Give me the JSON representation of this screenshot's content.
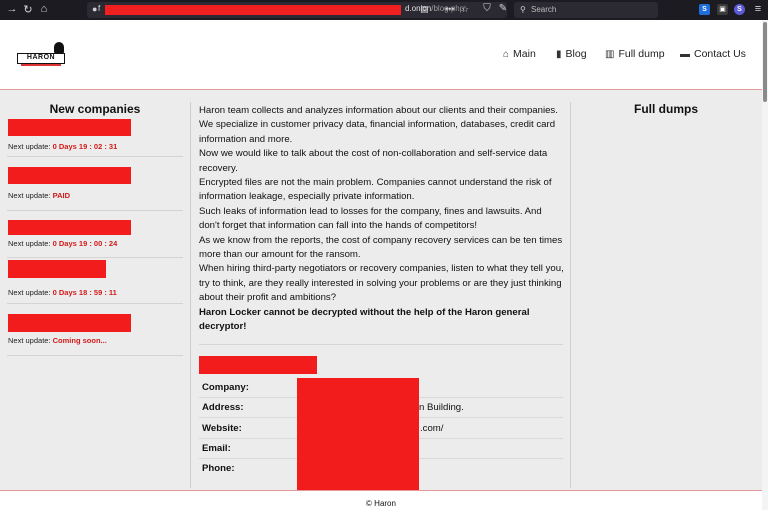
{
  "browser": {
    "url_visible_start": "f",
    "url_host_end": "d.onion",
    "url_path": "/blog.php",
    "search_placeholder": "Search"
  },
  "header": {
    "logo_text": "HARON",
    "nav": [
      {
        "label": "Main",
        "icon": "home-icon"
      },
      {
        "label": "Blog",
        "icon": "file-icon"
      },
      {
        "label": "Full dump",
        "icon": "book-icon"
      },
      {
        "label": "Contact Us",
        "icon": "chat-icon"
      }
    ]
  },
  "left": {
    "title": "New companies",
    "next_label": "Next update:",
    "companies": [
      {
        "status": "0 Days 19 : 02 : 31"
      },
      {
        "status": "PAID"
      },
      {
        "status": "0 Days 19 : 00 : 24"
      },
      {
        "status": "0 Days 18 : 59 : 11"
      },
      {
        "status": "Coming soon..."
      }
    ]
  },
  "main": {
    "paragraphs": [
      "Haron team collects and analyzes information about our clients and their companies. We specialize in customer privacy data, financial information, databases, credit card information and more.",
      "Now we would like to talk about the cost of non-collaboration and self-service data recovery.",
      "Encrypted files are not the main problem. Companies cannot understand the risk of information leakage, especially private information.",
      "Such leaks of information lead to losses for the company, fines and lawsuits. And don't forget that information can fall into the hands of competitors!",
      "As we know from the reports, the cost of company recovery services can be ten times more than our amount for the ransom.",
      "When hiring third-party negotiators or recovery companies, listen to what they tell you, try to think, are they really interested in solving your problems or are they just thinking about their profit and ambitions?"
    ],
    "bold_paragraph": "Haron Locker cannot be decrypted without the help of the Haron general decryptor!",
    "details": [
      {
        "label": "Company:",
        "value": ""
      },
      {
        "label": "Address:",
        "value": "n Building."
      },
      {
        "label": "Website:",
        "value": ".com/"
      },
      {
        "label": "Email:",
        "value": ""
      },
      {
        "label": "Phone:",
        "value": ""
      }
    ]
  },
  "right": {
    "title": "Full dumps"
  },
  "footer": {
    "text": "© Haron"
  },
  "colors": {
    "accent_red": "#d21a1a",
    "redaction": "#f21c1c",
    "header_border": "#e39a9a"
  }
}
